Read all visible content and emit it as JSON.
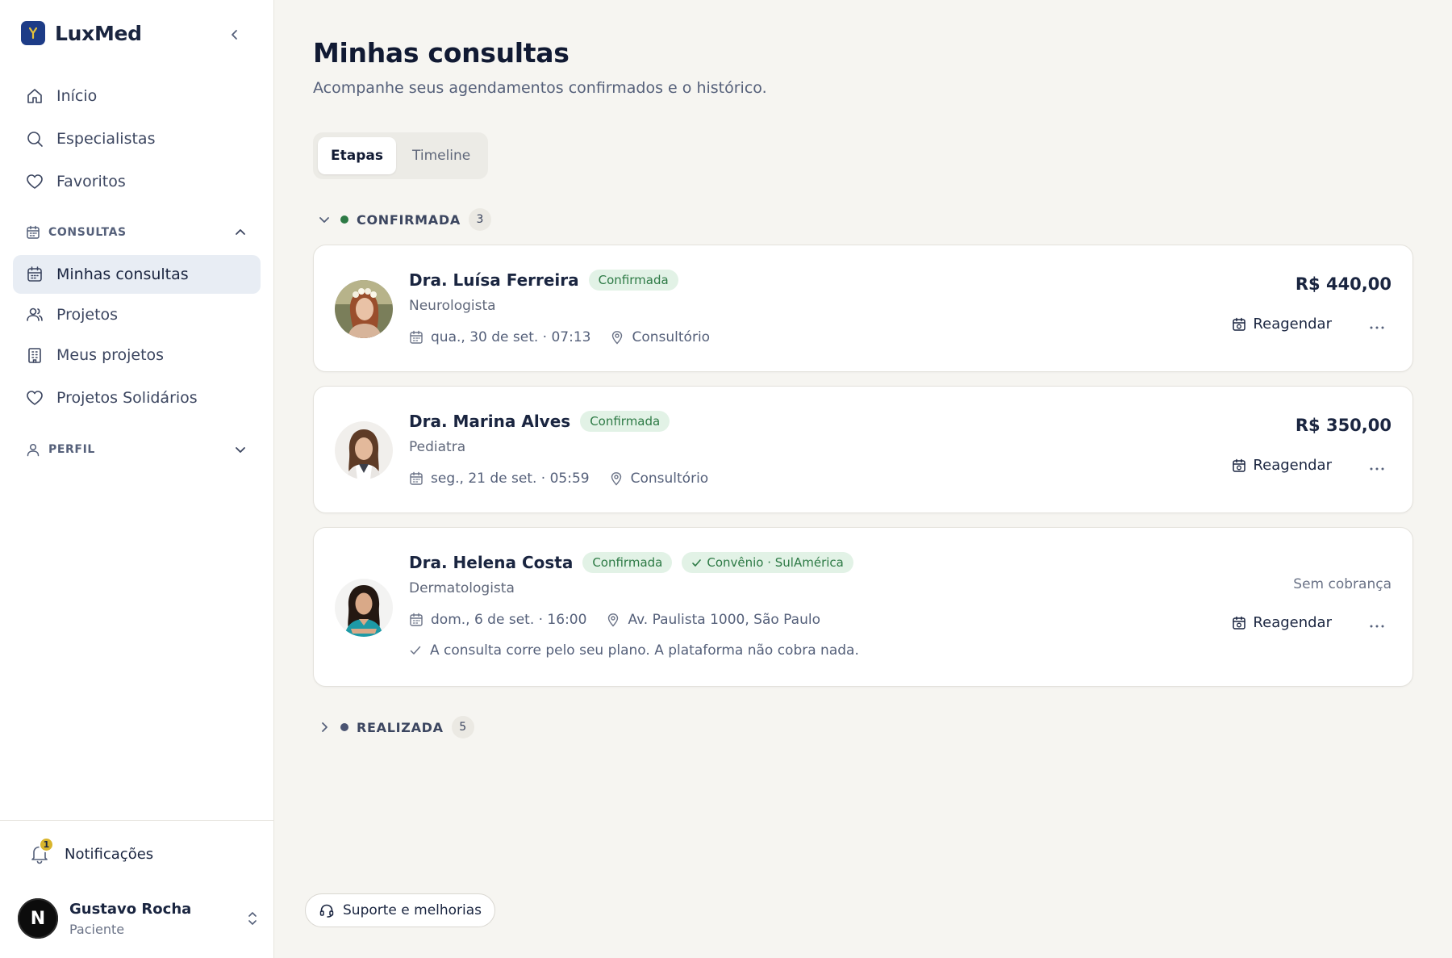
{
  "brand": {
    "name": "LuxMed"
  },
  "nav": {
    "inicio": "Início",
    "especialistas": "Especialistas",
    "favoritos": "Favoritos",
    "consultas_section": "CONSULTAS",
    "minhas_consultas": "Minhas consultas",
    "projetos": "Projetos",
    "meus_projetos": "Meus projetos",
    "projetos_solidarios": "Projetos Solidários",
    "perfil_section": "PERFIL"
  },
  "footer": {
    "notifications_label": "Notificações",
    "notifications_count": "1",
    "user_initial": "N",
    "user_name": "Gustavo Rocha",
    "user_role": "Paciente"
  },
  "page": {
    "title": "Minhas consultas",
    "subtitle": "Acompanhe seus agendamentos confirmados e o histórico."
  },
  "tabs": [
    {
      "label": "Etapas",
      "active": true
    },
    {
      "label": "Timeline",
      "active": false
    }
  ],
  "groups": {
    "confirmed": {
      "title": "CONFIRMADA",
      "count": "3",
      "color": "#2d7a45"
    },
    "done": {
      "title": "REALIZADA",
      "count": "5",
      "color": "#4a5472"
    }
  },
  "appointments": [
    {
      "doctor": "Dra. Luísa Ferreira",
      "status": "Confirmada",
      "specialty": "Neurologista",
      "datetime": "qua., 30 de set. · 07:13",
      "location": "Consultório",
      "price": "R$ 440,00",
      "action": "Reagendar"
    },
    {
      "doctor": "Dra. Marina Alves",
      "status": "Confirmada",
      "specialty": "Pediatra",
      "datetime": "seg., 21 de set. · 05:59",
      "location": "Consultório",
      "price": "R$ 350,00",
      "action": "Reagendar"
    },
    {
      "doctor": "Dra. Helena Costa",
      "status": "Confirmada",
      "insurance": "Convênio · SulAmérica",
      "specialty": "Dermatologista",
      "datetime": "dom., 6 de set. · 16:00",
      "location": "Av. Paulista 1000, São Paulo",
      "note": "A consulta corre pelo seu plano. A plataforma não cobra nada.",
      "price": "Sem cobrança",
      "action": "Reagendar"
    }
  ],
  "support": {
    "label": "Suporte e melhorias"
  },
  "colors": {
    "accent": "#1d3c87",
    "success": "#2d7a45",
    "success_bg": "#e2f2e6",
    "badge_yellow": "#d9b52c"
  }
}
